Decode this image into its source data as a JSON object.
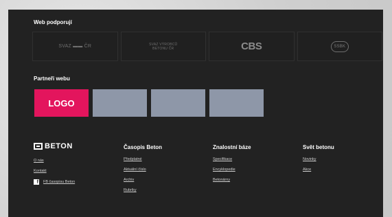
{
  "supporters": {
    "title": "Web podporují",
    "items": [
      {
        "text": "SVAZ ▬▬ ČR"
      },
      {
        "text": "Svaz Výrobců Betonu ČR"
      },
      {
        "text": "CBS"
      },
      {
        "text": "SSBK"
      }
    ]
  },
  "partners": {
    "title": "Partneři webu",
    "logo_text": "LOGO",
    "logo_color": "#e3155d",
    "placeholder_color": "#8e97a8"
  },
  "footer": {
    "brand": "BETON",
    "links": [
      "O nás",
      "Kontakt",
      "FB časopisu Beton"
    ],
    "columns": [
      {
        "title": "Časopis Beton",
        "links": [
          "Předplatné",
          "Aktuální číslo",
          "Archiv",
          "Rubriky"
        ]
      },
      {
        "title": "Znalostní báze",
        "links": [
          "Specifikace",
          "Encyklopedie",
          "Betonárny"
        ]
      },
      {
        "title": "Svět betonu",
        "links": [
          "Novinky",
          "Akce"
        ]
      }
    ]
  }
}
